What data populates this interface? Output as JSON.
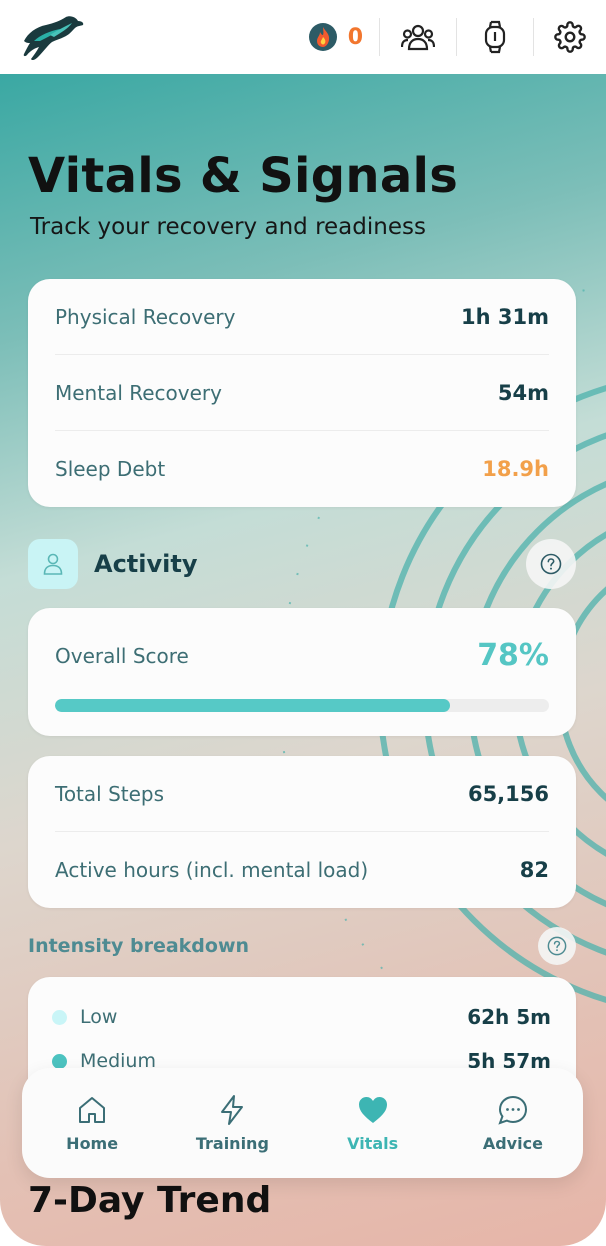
{
  "header": {
    "streak_count": "0",
    "icons": [
      "panther-logo",
      "flame-icon",
      "community-icon",
      "device-icon",
      "gear-icon"
    ]
  },
  "page": {
    "title": "Vitals & Signals",
    "subtitle": "Track your recovery and readiness"
  },
  "recovery": {
    "items": [
      {
        "label": "Physical Recovery",
        "value": "1h 31m"
      },
      {
        "label": "Mental Recovery",
        "value": "54m"
      },
      {
        "label": "Sleep Debt",
        "value": "18.9h"
      }
    ]
  },
  "activity": {
    "title": "Activity",
    "overall_score_label": "Overall Score",
    "overall_score_value": "78%",
    "overall_score_fraction": 0.8,
    "stats": [
      {
        "label": "Total Steps",
        "value": "65,156"
      },
      {
        "label": "Active hours (incl. mental load)",
        "value": "82"
      }
    ]
  },
  "intensity": {
    "title": "Intensity breakdown",
    "rows": [
      {
        "label": "Low",
        "value": "62h 5m",
        "color": "#c9f5f7"
      },
      {
        "label": "Medium",
        "value": "5h 57m",
        "color": "#4cc3c0"
      }
    ]
  },
  "next_section_peek": "7-Day Trend",
  "nav": {
    "items": [
      {
        "label": "Home",
        "icon": "home-icon"
      },
      {
        "label": "Training",
        "icon": "lightning-icon"
      },
      {
        "label": "Vitals",
        "icon": "heart-icon",
        "active": true
      },
      {
        "label": "Advice",
        "icon": "chat-bubble-icon"
      }
    ]
  },
  "colors": {
    "accent": "#4cc3c0",
    "streak": "#f2762e",
    "warning": "#f2a04a",
    "dark_text": "#173f48"
  }
}
